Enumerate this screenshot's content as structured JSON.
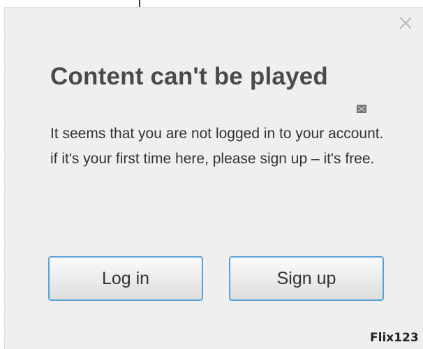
{
  "dialog": {
    "title": "Content can't be played",
    "message_line1": "It seems that you are not logged in to your account.",
    "message_line2": "if it's your first time here, please sign up – it's free.",
    "login_label": "Log in",
    "signup_label": "Sign up",
    "brand": "Flix123",
    "close_icon": "close-icon",
    "mail_icon": "mail-icon"
  },
  "colors": {
    "dialog_background": "#efefef",
    "button_border": "#5aa3d6",
    "title_text": "#4a4a4a"
  }
}
